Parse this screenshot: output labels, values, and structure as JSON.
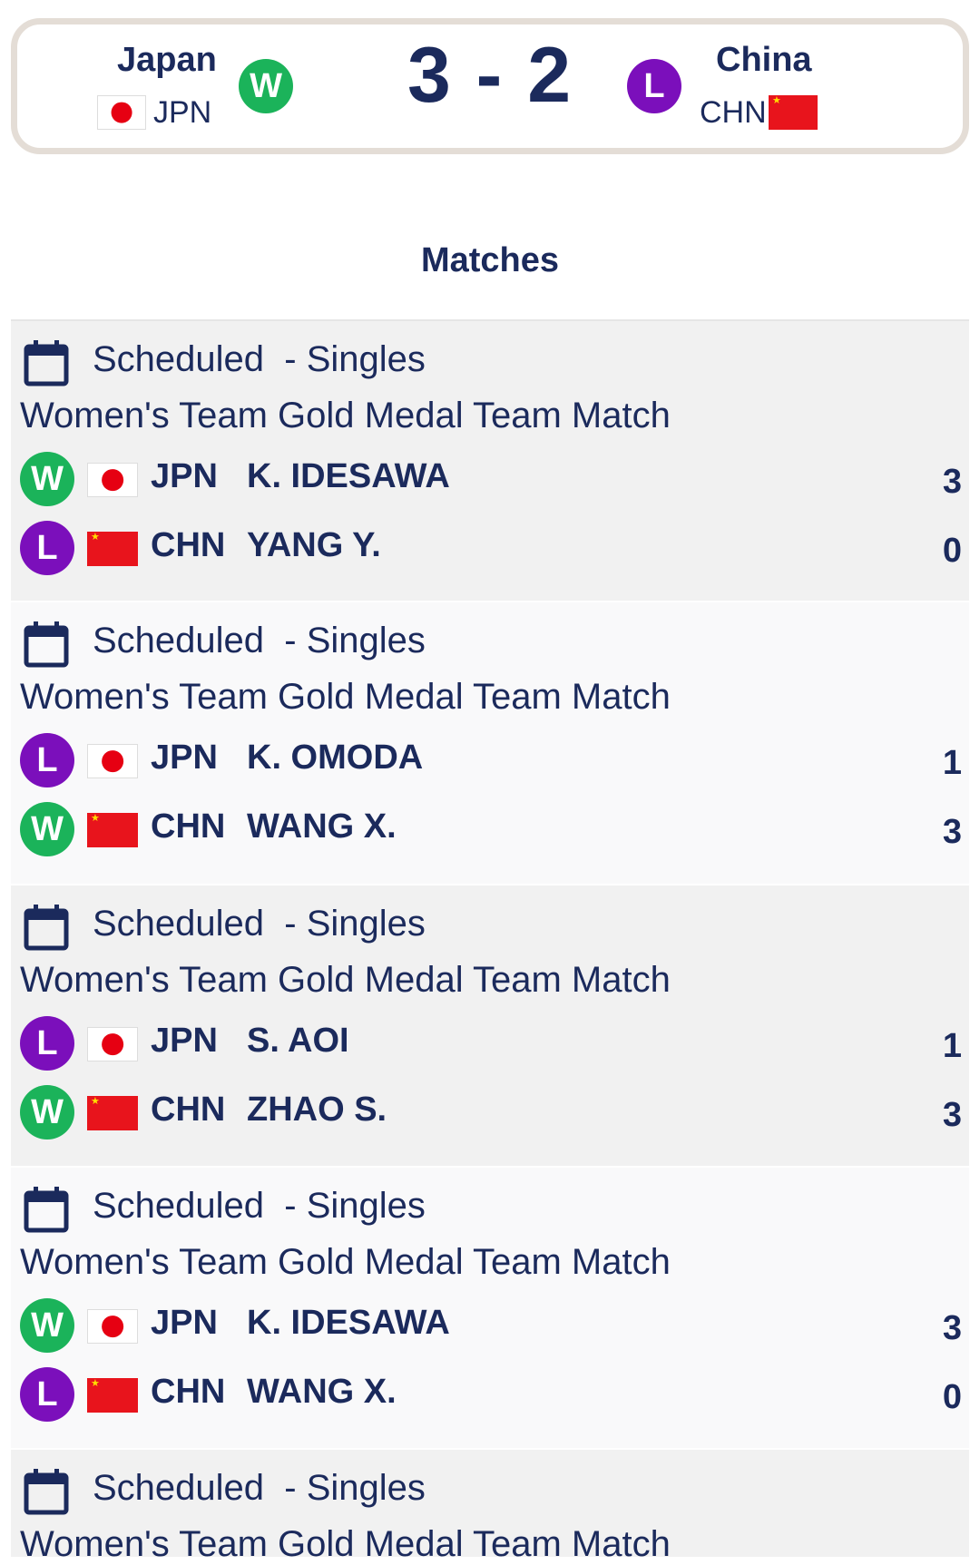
{
  "scoreboard": {
    "home": {
      "name": "Japan",
      "code": "JPN",
      "result": "W"
    },
    "away": {
      "name": "China",
      "code": "CHN",
      "result": "L"
    },
    "score": "3 - 2"
  },
  "matches_heading": "Matches",
  "colors": {
    "win": "#1bb35a",
    "loss": "#7b0fbb",
    "text": "#1b2a5c",
    "card_shaded": "#f1f1f1",
    "card_light": "#f9f9fa"
  },
  "matches": [
    {
      "status": "Scheduled",
      "type": "- Singles",
      "event": "Women's Team Gold Medal Team Match",
      "players": [
        {
          "result": "W",
          "country": "JPN",
          "name": "K. IDESAWA",
          "score": "3"
        },
        {
          "result": "L",
          "country": "CHN",
          "name": "YANG Y.",
          "score": "0"
        }
      ]
    },
    {
      "status": "Scheduled",
      "type": "- Singles",
      "event": "Women's Team Gold Medal Team Match",
      "players": [
        {
          "result": "L",
          "country": "JPN",
          "name": "K. OMODA",
          "score": "1"
        },
        {
          "result": "W",
          "country": "CHN",
          "name": "WANG X.",
          "score": "3"
        }
      ]
    },
    {
      "status": "Scheduled",
      "type": "- Singles",
      "event": "Women's Team Gold Medal Team Match",
      "players": [
        {
          "result": "L",
          "country": "JPN",
          "name": "S. AOI",
          "score": "1"
        },
        {
          "result": "W",
          "country": "CHN",
          "name": "ZHAO S.",
          "score": "3"
        }
      ]
    },
    {
      "status": "Scheduled",
      "type": "- Singles",
      "event": "Women's Team Gold Medal Team Match",
      "players": [
        {
          "result": "W",
          "country": "JPN",
          "name": "K. IDESAWA",
          "score": "3"
        },
        {
          "result": "L",
          "country": "CHN",
          "name": "WANG X.",
          "score": "0"
        }
      ]
    },
    {
      "status": "Scheduled",
      "type": "- Singles",
      "event": "Women's Team Gold Medal Team Match",
      "players": []
    }
  ]
}
